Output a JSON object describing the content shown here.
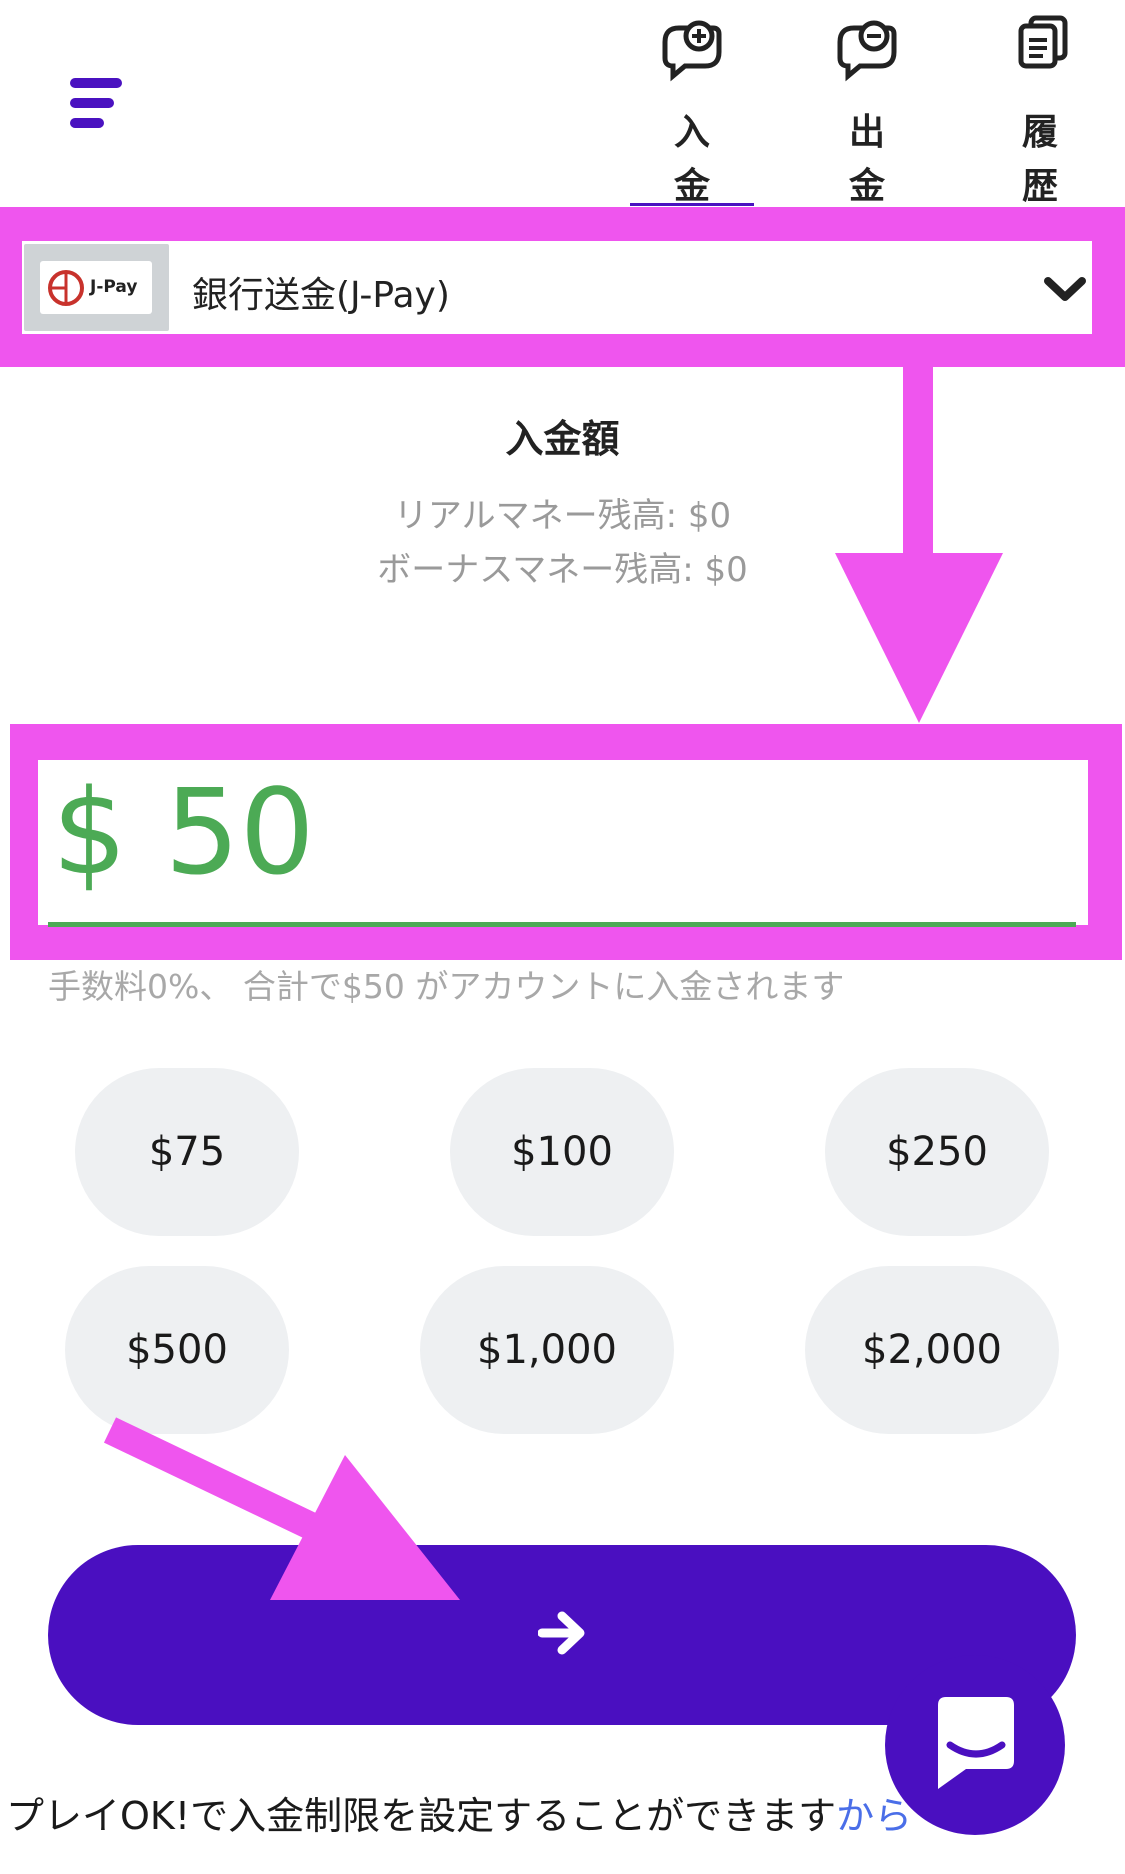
{
  "header": {
    "tabs": [
      {
        "label": "入金",
        "icon": "deposit-icon",
        "active": true
      },
      {
        "label": "出金",
        "icon": "withdraw-icon",
        "active": false
      },
      {
        "label": "履歴",
        "icon": "history-icon",
        "active": false
      }
    ]
  },
  "method": {
    "logo_text": "J-Pay",
    "label": "銀行送金(J-Pay)"
  },
  "amount": {
    "title": "入金額",
    "real_balance": "リアルマネー残高: $0",
    "bonus_balance": "ボーナスマネー残高: $0",
    "value": "$ 50",
    "fee_note": "手数料0%、 合計で$50 がアカウントに入金されます"
  },
  "presets": [
    "$75",
    "$100",
    "$250",
    "$500",
    "$1,000",
    "$2,000"
  ],
  "footer": {
    "note": "プレイOK!で入金制限を設定することができます",
    "link": "から"
  },
  "colors": {
    "accent": "#4a0fc0",
    "amount": "#4caa55",
    "highlight": "#ef55ee"
  }
}
